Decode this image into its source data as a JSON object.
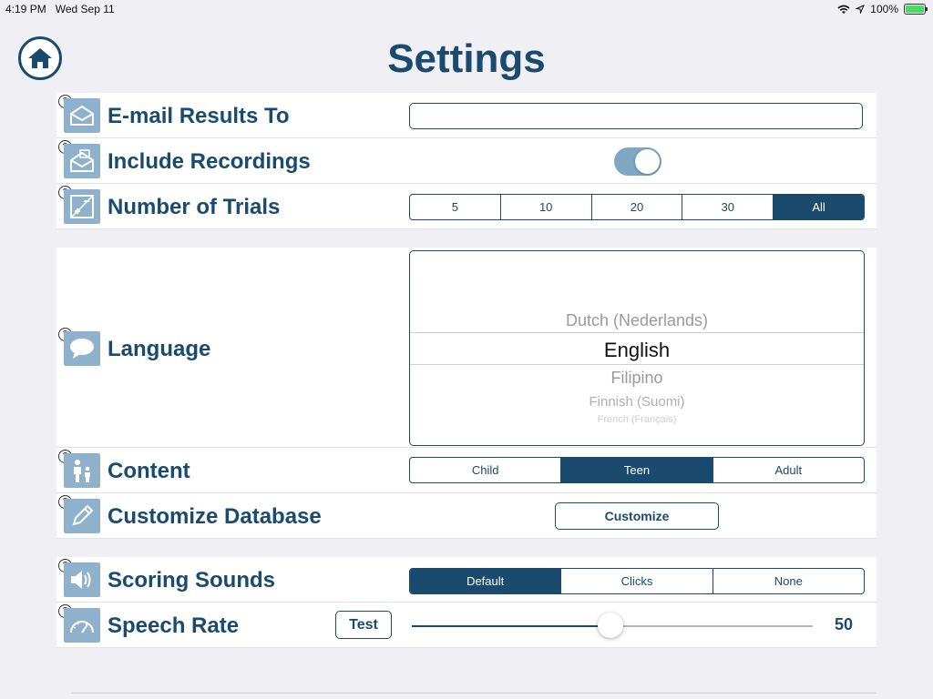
{
  "status_bar": {
    "time": "4:19 PM",
    "date": "Wed Sep 11",
    "battery": "100%"
  },
  "title": "Settings",
  "rows": {
    "email": {
      "label": "E-mail Results To",
      "value": ""
    },
    "recordings": {
      "label": "Include Recordings",
      "toggle_on": true
    },
    "trials": {
      "label": "Number of Trials",
      "options": [
        "5",
        "10",
        "20",
        "30",
        "All"
      ],
      "selected": "All"
    },
    "language": {
      "label": "Language",
      "options": [
        "Dutch (Nederlands)",
        "English",
        "Filipino",
        "Finnish (Suomi)",
        "French (Français)"
      ],
      "selected": "English"
    },
    "content": {
      "label": "Content",
      "options": [
        "Child",
        "Teen",
        "Adult"
      ],
      "selected": "Teen"
    },
    "customize": {
      "label": "Customize Database",
      "button": "Customize"
    },
    "scoring": {
      "label": "Scoring Sounds",
      "options": [
        "Default",
        "Clicks",
        "None"
      ],
      "selected": "Default"
    },
    "speech": {
      "label": "Speech Rate",
      "test_button": "Test",
      "value": "50"
    }
  },
  "help_glyph": "?",
  "colors": {
    "accent": "#1a4a6e",
    "icon_bg": "#8fb1cc",
    "background": "#efeff4"
  }
}
